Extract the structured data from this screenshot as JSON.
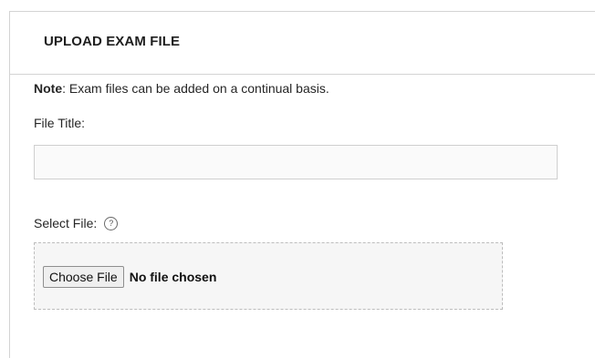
{
  "header": {
    "title": "UPLOAD EXAM FILE"
  },
  "note": {
    "label": "Note",
    "text": ": Exam files can be added on a continual basis."
  },
  "file_title": {
    "label": "File Title:",
    "value": "",
    "placeholder": ""
  },
  "select_file": {
    "label": "Select File:",
    "help_icon": "?",
    "button_label": "Choose File",
    "status": "No file chosen"
  },
  "icons": {
    "help": "help-circle-icon"
  }
}
